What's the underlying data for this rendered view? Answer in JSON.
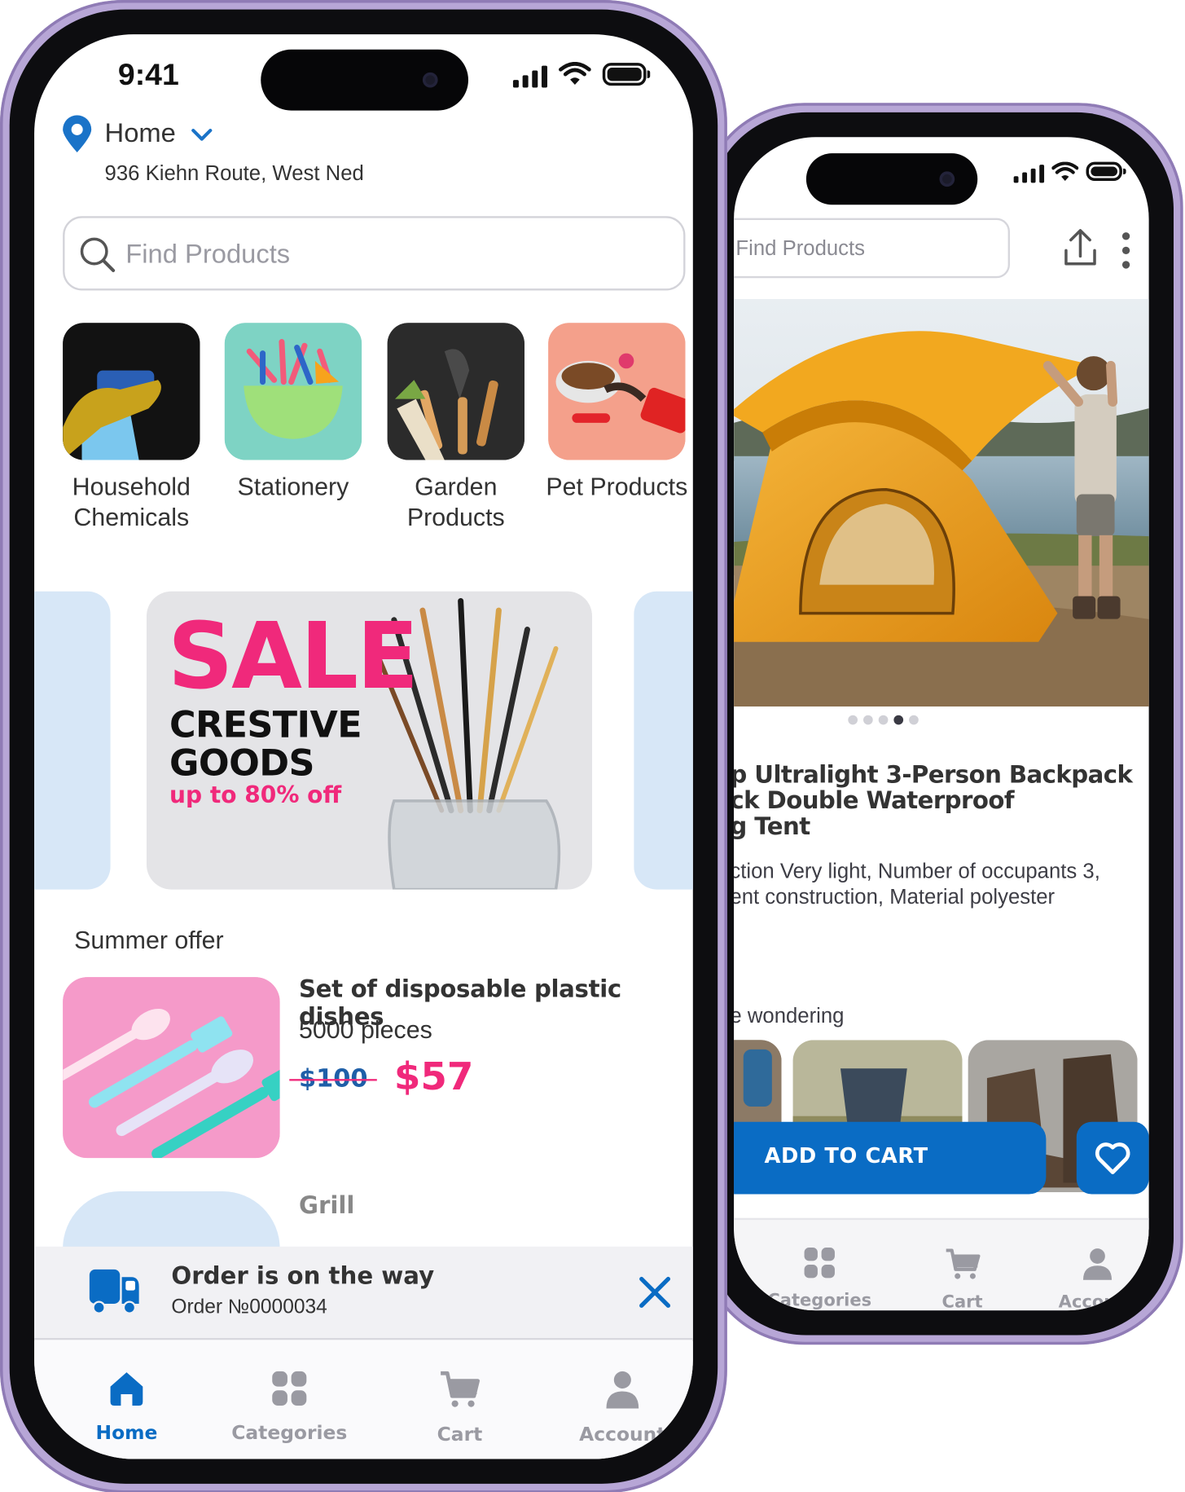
{
  "colors": {
    "accent_blue": "#0a6cc4",
    "sale_pink": "#f0297b",
    "frame_lavender": "#b7a6d6",
    "light_blue_card": "#d7e7f7"
  },
  "front": {
    "status": {
      "time": "9:41"
    },
    "location": {
      "label": "Home",
      "address": "936 Kiehn Route, West Ned",
      "icon": "map-pin-icon"
    },
    "search": {
      "placeholder": "Find Products",
      "icon": "search-icon"
    },
    "categories": [
      {
        "label": "Household\nChemicals"
      },
      {
        "label": "Stationery"
      },
      {
        "label": "Garden\nProducts"
      },
      {
        "label": "Pet Products"
      }
    ],
    "banner": {
      "headline": "SALE",
      "subtitle": "CRESTIVE\nGOODS",
      "discount": "up to 80% off"
    },
    "summer_offer": {
      "heading": "Summer offer",
      "product_title": "Set of disposable plastic dishes",
      "quantity": "5000 pieces",
      "old_price": "$100",
      "new_price": "$57"
    },
    "next_item": {
      "title": "Grill"
    },
    "order_bar": {
      "title": "Order is on the way",
      "order_number": "Order №0000034"
    },
    "tabs": [
      {
        "label": "Home",
        "icon": "home-icon",
        "active": true
      },
      {
        "label": "Categories",
        "icon": "grid-icon"
      },
      {
        "label": "Cart",
        "icon": "cart-icon"
      },
      {
        "label": "Account",
        "icon": "user-icon"
      }
    ]
  },
  "back": {
    "search": {
      "placeholder": "Find Products"
    },
    "product": {
      "title": "p Ultralight 3-Person Backpack\nck Double Waterproof\ng Tent",
      "description": "ction Very light, Number of occupants 3,\nent construction, Material polyester"
    },
    "gallery": {
      "dots": 5,
      "active_dot": 4
    },
    "related_heading": "e wondering",
    "add_to_cart": "ADD TO CART",
    "tabs": [
      {
        "label": "Categories",
        "icon": "grid-icon"
      },
      {
        "label": "Cart",
        "icon": "cart-icon"
      },
      {
        "label": "Account",
        "icon": "user-icon"
      }
    ]
  }
}
